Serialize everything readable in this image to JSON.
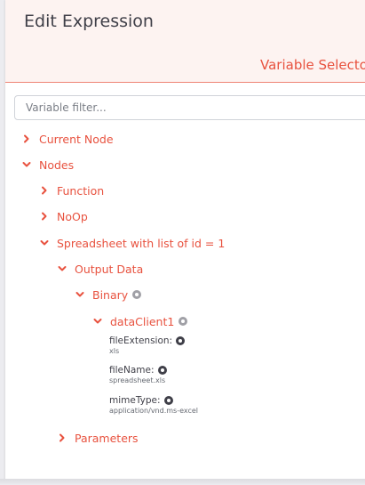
{
  "dialog": {
    "title": "Edit Expression",
    "section_title": "Variable Selecto"
  },
  "filter": {
    "placeholder": "Variable filter..."
  },
  "tree": {
    "current_node": "Current Node",
    "nodes": "Nodes",
    "function": "Function",
    "noop": "NoOp",
    "spreadsheet": "Spreadsheet with list of id = 1",
    "output_data": "Output Data",
    "binary": "Binary",
    "data_client": "dataClient1",
    "parameters": "Parameters"
  },
  "properties": [
    {
      "key": "fileExtension:",
      "value": "xls"
    },
    {
      "key": "fileName:",
      "value": "spreadsheet.xls"
    },
    {
      "key": "mimeType:",
      "value": "application/vnd.ms-excel"
    }
  ],
  "colors": {
    "accent": "#e8523f",
    "header_bg": "#fdf3f1",
    "text_dark": "#3f3f48",
    "info_icon": "#a0a0a6"
  },
  "icons": {
    "collapsed": "chevron-right-icon",
    "expanded": "chevron-down-icon",
    "info": "info-icon"
  }
}
